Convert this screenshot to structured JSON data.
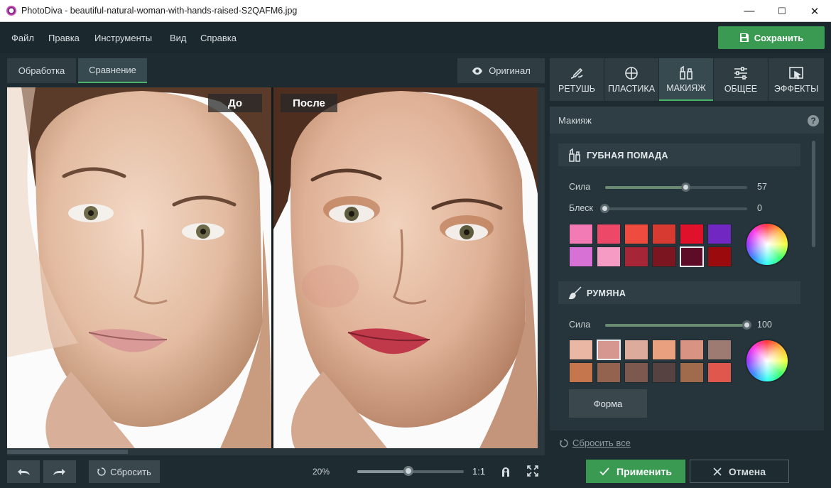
{
  "window": {
    "title": "PhotoDiva - beautiful-natural-woman-with-hands-raised-S2QAFM6.jpg",
    "minimize_glyph": "—",
    "maximize_glyph": "☐",
    "close_glyph": "✕"
  },
  "menu": {
    "items": [
      "Файл",
      "Правка",
      "Инструменты",
      "Вид",
      "Справка"
    ],
    "save_label": "Сохранить",
    "save_icon": "floppy-disk-icon"
  },
  "view_tabs": {
    "items": [
      "Обработка",
      "Сравнение"
    ],
    "active": "Сравнение",
    "original_label": "Оригинал",
    "original_icon": "eye-icon"
  },
  "compare": {
    "before_label": "До",
    "after_label": "После"
  },
  "bottom": {
    "undo_icon": "undo-icon",
    "redo_icon": "redo-icon",
    "reset_label": "Сбросить",
    "zoom_value": "20%",
    "zoom_level": 0.48,
    "one_to_one": "1:1",
    "fit_icon": "fit-to-screen-icon",
    "fullscreen_icon": "fullscreen-icon"
  },
  "tool_tabs": {
    "items": [
      {
        "label": "РЕТУШЬ",
        "icon": "retouch-brush-icon"
      },
      {
        "label": "ПЛАСТИКА",
        "icon": "liquify-icon"
      },
      {
        "label": "МАКИЯЖ",
        "icon": "makeup-icon"
      },
      {
        "label": "ОБЩЕЕ",
        "icon": "sliders-icon"
      },
      {
        "label": "ЭФФЕКТЫ",
        "icon": "effects-icon"
      }
    ],
    "active": "МАКИЯЖ"
  },
  "panel": {
    "title": "Макияж",
    "help": "?",
    "lipstick": {
      "title": "ГУБНАЯ ПОМАДА",
      "icon": "lipstick-icon",
      "strength_label": "Сила",
      "strength_value": "57",
      "strength_level": 0.57,
      "gloss_label": "Блеск",
      "gloss_value": "0",
      "gloss_level": 0.0,
      "swatches": [
        "#f27bb6",
        "#ee4868",
        "#ef4b3f",
        "#d63a30",
        "#e0112a",
        "#7127c2",
        "#d871d6",
        "#f59bc4",
        "#a62638",
        "#7b1620",
        "#5e0b27",
        "#9b0a0c"
      ],
      "selected_index": 10
    },
    "blush": {
      "title": "РУМЯНА",
      "icon": "blush-brush-icon",
      "strength_label": "Сила",
      "strength_value": "100",
      "strength_level": 1.0,
      "swatches": [
        "#e9b7a4",
        "#d79791",
        "#dcab9c",
        "#e9a07f",
        "#d89383",
        "#9e7b72",
        "#c6764c",
        "#93634f",
        "#7c584e",
        "#574242",
        "#a06a4d",
        "#e0574d"
      ],
      "selected_index": 1,
      "shape_label": "Форма"
    },
    "reset_all": "Сбросить все"
  },
  "actions": {
    "apply_label": "Применить",
    "cancel_label": "Отмена"
  }
}
